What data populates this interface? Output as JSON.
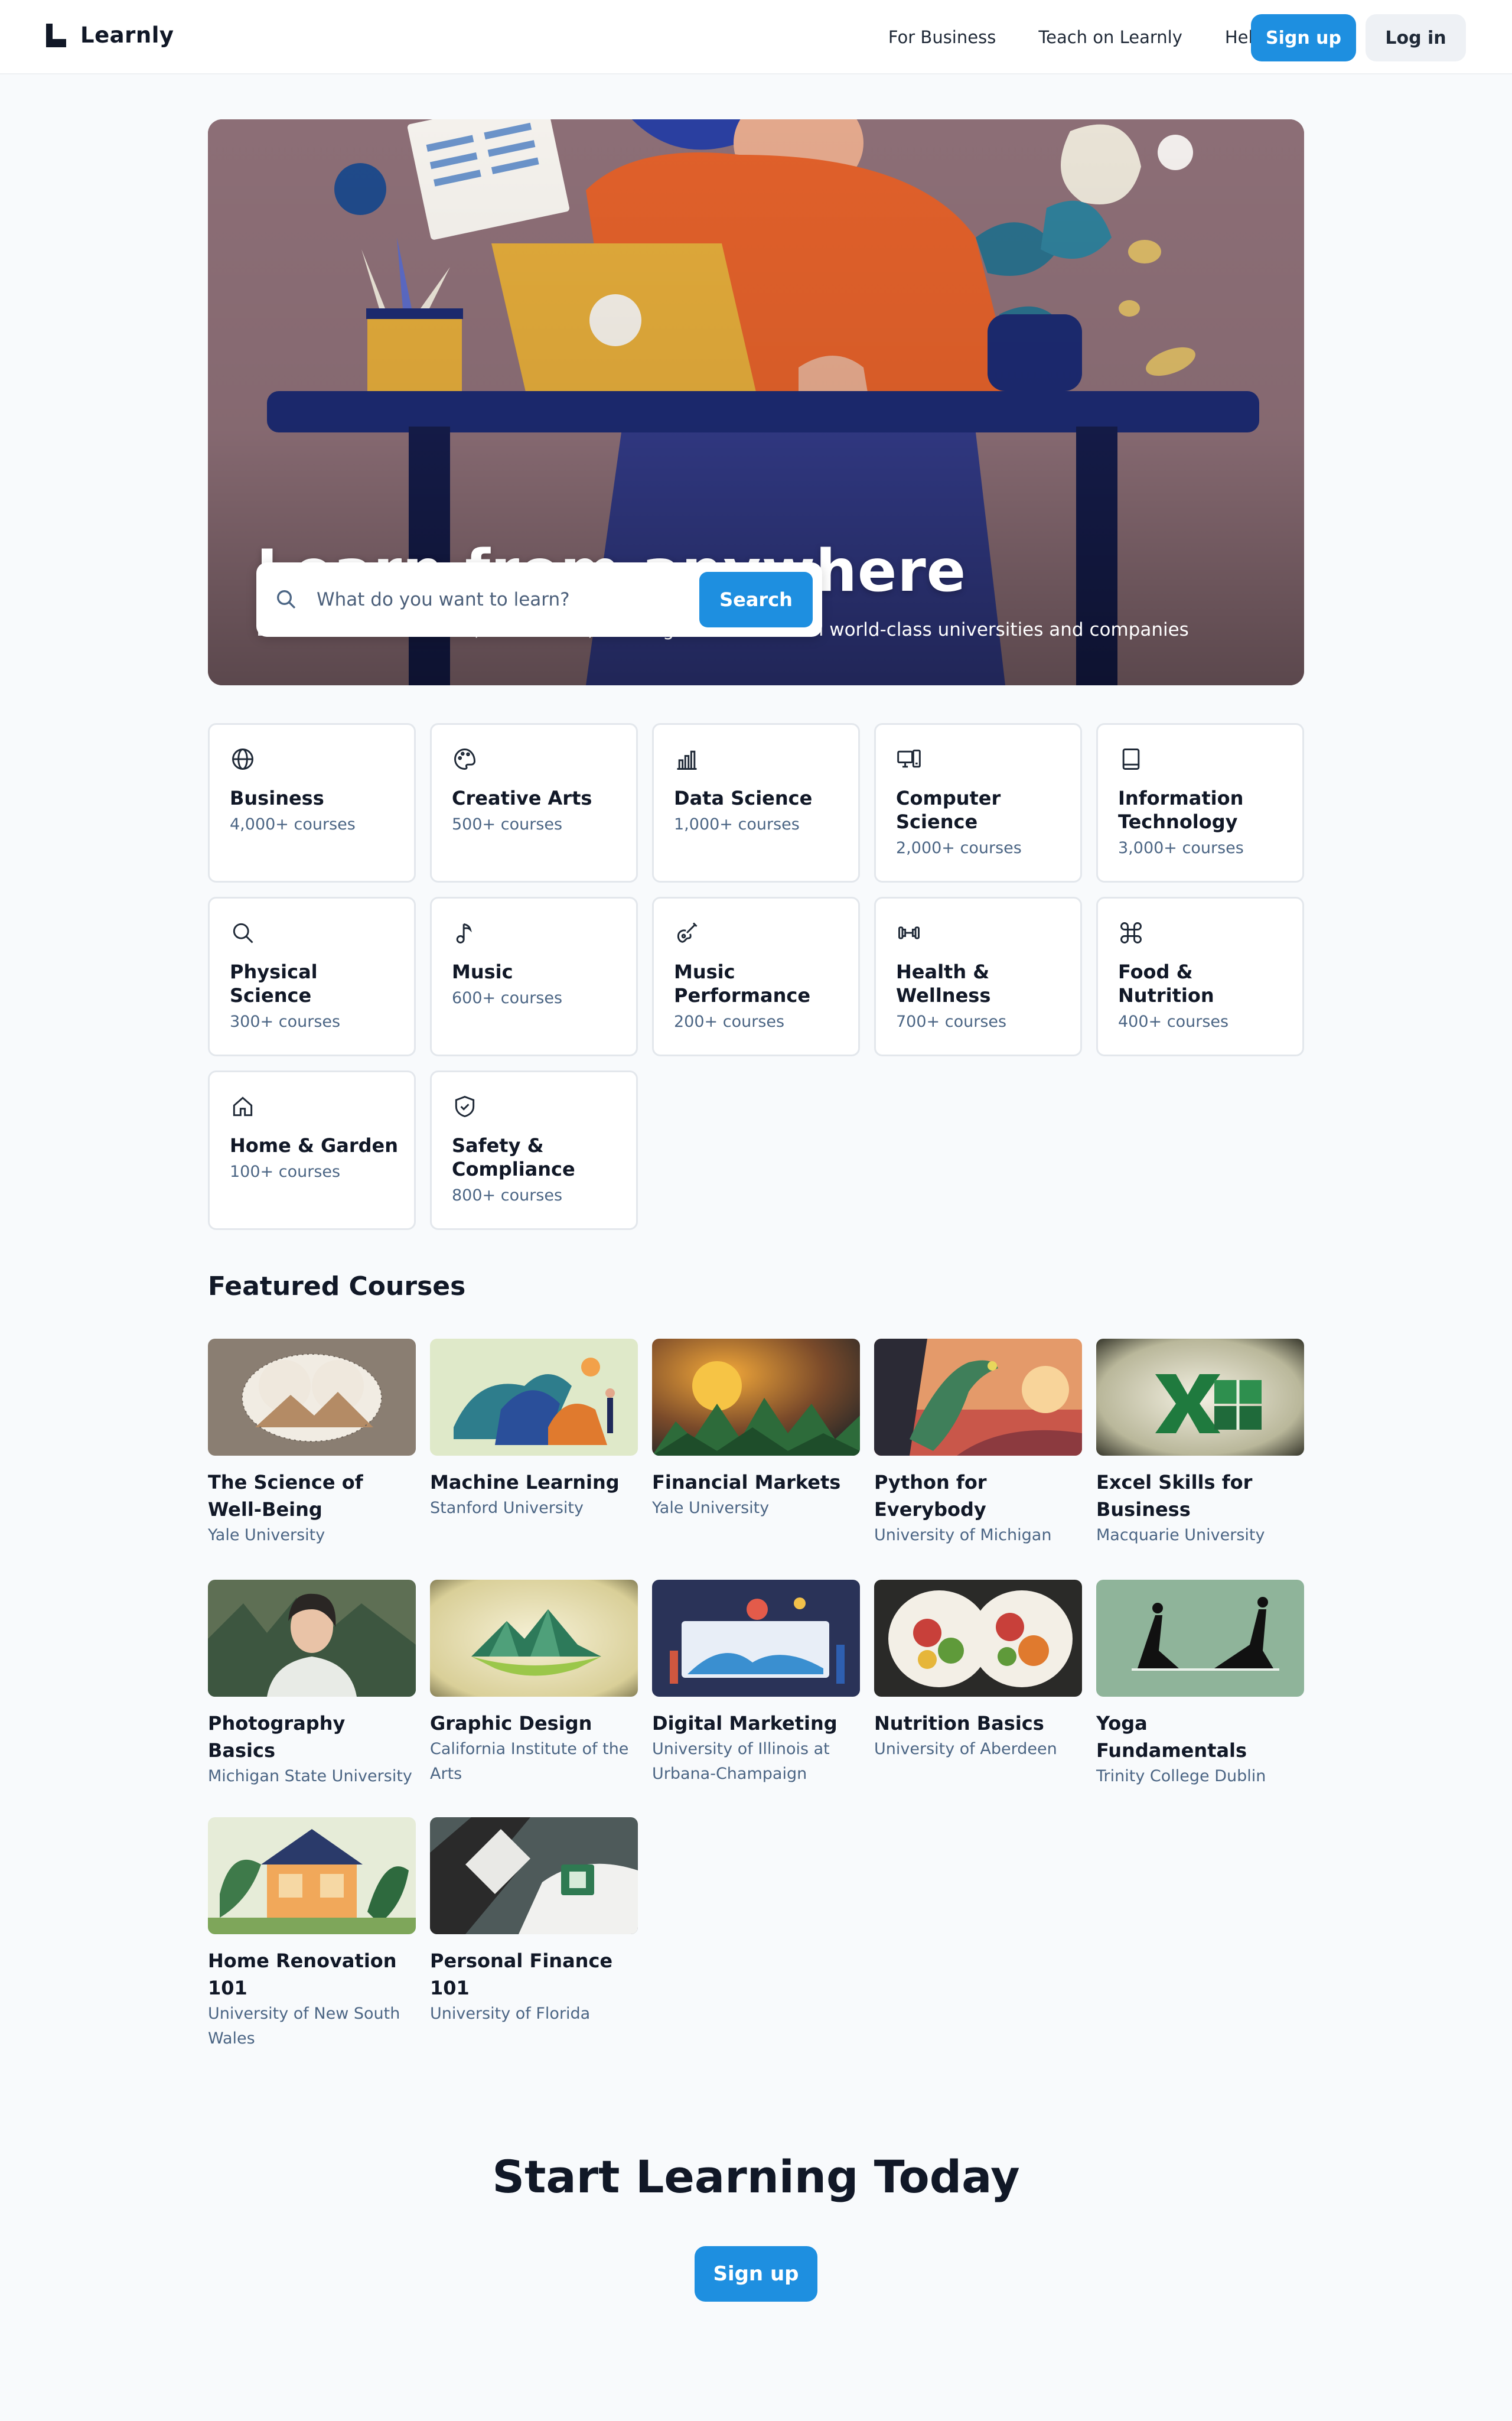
{
  "nav": {
    "brand": "Learnly",
    "links": [
      "For Business",
      "Teach on Learnly",
      "Help"
    ],
    "signup_label": "Sign up",
    "login_label": "Log in"
  },
  "hero": {
    "title": "Learn from anywhere",
    "subtitle": "Build skills with courses, certificates, and degrees online from world-class universities and companies",
    "search_placeholder": "What do you want to learn?",
    "search_button": "Search"
  },
  "categories": [
    {
      "name": "Business",
      "count": "4,000+ courses",
      "icon": "globe-icon"
    },
    {
      "name": "Creative Arts",
      "count": "500+ courses",
      "icon": "palette-icon"
    },
    {
      "name": "Data Science",
      "count": "1,000+ courses",
      "icon": "bar-chart-icon"
    },
    {
      "name": "Computer Science",
      "count": "2,000+ courses",
      "icon": "devices-icon"
    },
    {
      "name": "Information Technology",
      "count": "3,000+ courses",
      "icon": "tablet-icon"
    },
    {
      "name": "Physical Science",
      "count": "300+ courses",
      "icon": "magnifier-icon"
    },
    {
      "name": "Music",
      "count": "600+ courses",
      "icon": "music-note-icon"
    },
    {
      "name": "Music Performance",
      "count": "200+ courses",
      "icon": "guitar-icon"
    },
    {
      "name": "Health & Wellness",
      "count": "700+ courses",
      "icon": "dumbbell-icon"
    },
    {
      "name": "Food & Nutrition",
      "count": "400+ courses",
      "icon": "command-icon"
    },
    {
      "name": "Home & Garden",
      "count": "100+ courses",
      "icon": "home-icon"
    },
    {
      "name": "Safety & Compliance",
      "count": "800+ courses",
      "icon": "shield-check-icon"
    }
  ],
  "featured": {
    "heading": "Featured Courses",
    "courses": [
      {
        "title": "The Science of Well-Being",
        "university": "Yale University"
      },
      {
        "title": "Machine Learning",
        "university": "Stanford University"
      },
      {
        "title": "Financial Markets",
        "university": "Yale University"
      },
      {
        "title": "Python for Everybody",
        "university": "University of Michigan"
      },
      {
        "title": "Excel Skills for Business",
        "university": "Macquarie University"
      },
      {
        "title": "Photography Basics",
        "university": "Michigan State University"
      },
      {
        "title": "Graphic Design",
        "university": "California Institute of the Arts"
      },
      {
        "title": "Digital Marketing",
        "university": "University of Illinois at Urbana-Champaign"
      },
      {
        "title": "Nutrition Basics",
        "university": "University of Aberdeen"
      },
      {
        "title": "Yoga Fundamentals",
        "university": "Trinity College Dublin"
      },
      {
        "title": "Home Renovation 101",
        "university": "University of New South Wales"
      },
      {
        "title": "Personal Finance 101",
        "university": "University of Florida"
      }
    ]
  },
  "cta": {
    "title": "Start Learning Today",
    "button": "Sign up"
  }
}
